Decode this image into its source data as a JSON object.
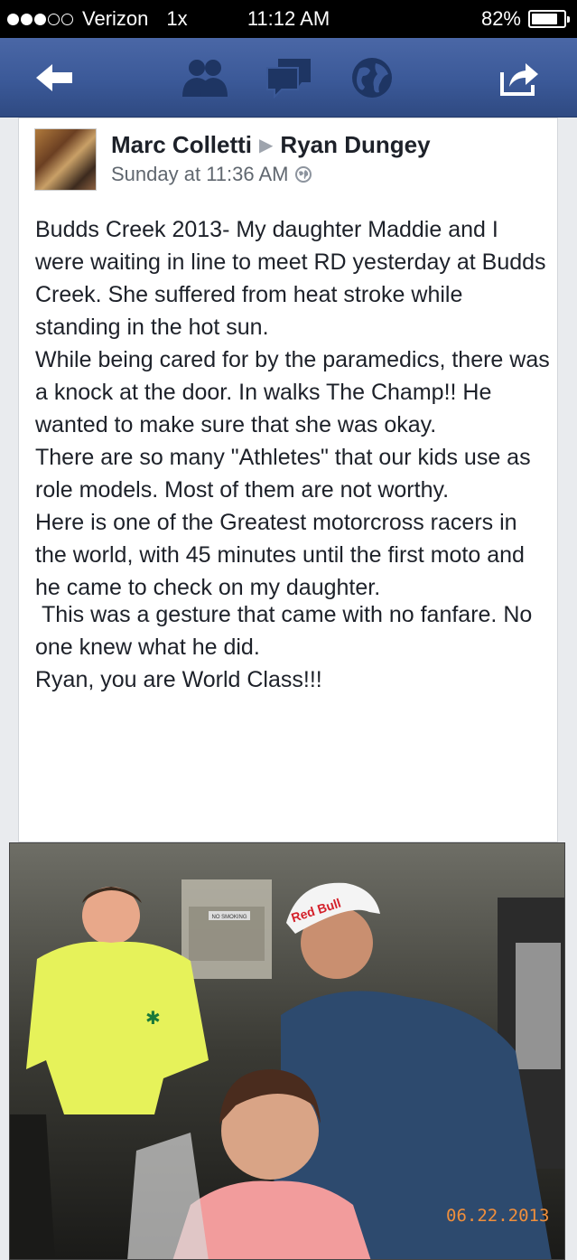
{
  "status_bar": {
    "carrier": "Verizon",
    "network": "1x",
    "time": "11:12 AM",
    "battery_percent": "82%",
    "battery_level": 0.82,
    "signal_bars_filled": 3,
    "signal_bars_total": 5
  },
  "nav_bar": {
    "back_icon": "back-arrow-icon",
    "friends_icon": "friends-icon",
    "messages_icon": "messages-icon",
    "notifications_icon": "globe-icon",
    "share_icon": "share-icon",
    "color": "#3b5998"
  },
  "post": {
    "author": "Marc Colletti",
    "recipient": "Ryan Dungey",
    "timestamp": "Sunday at 11:36 AM",
    "privacy_icon": "globe-icon",
    "paragraphs": [
      "Budds Creek 2013- My daughter Maddie and I were waiting in line to meet RD yesterday at Budds Creek. She suffered from heat stroke while standing in the hot sun.",
      "While being cared for by the paramedics, there was a knock at the door. In walks The Champ!! He wanted to make sure that she was okay.",
      "There are so many \"Athletes\" that our kids use as role models. Most of them are not worthy.",
      "Here is one of the Greatest motorcross racers in the world, with 45 minutes until the first moto and he came to check on my daughter.",
      " This was a gesture that came with no fanfare. No one knew what he did.",
      "Ryan, you are World Class!!!"
    ]
  },
  "photo": {
    "date_stamp": "06.22.2013",
    "sign_text": "NO SMOKING",
    "cap_text": "Red Bull"
  }
}
